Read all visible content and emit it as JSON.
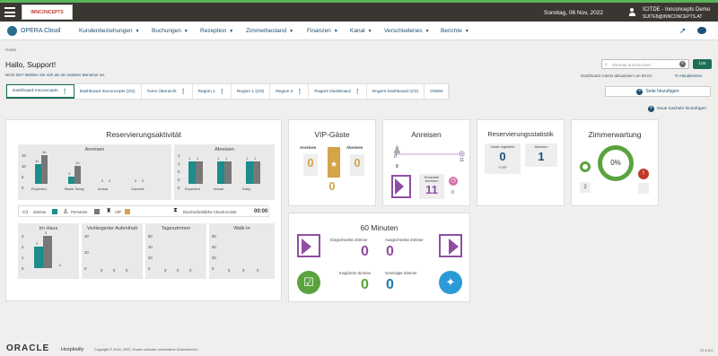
{
  "topbar": {
    "date": "Sonntag, 06 Nov, 2022",
    "user_line1": "ICITDE - Innconcepts Demo",
    "user_line2": "SUITE8@INNCONCEPTS.AT",
    "logo_text": "INNCONCEPTS"
  },
  "nav": {
    "app": "OPERA Cloud",
    "items": [
      "Kundenbeziehungen",
      "Buchungen",
      "Rezeption",
      "Zimmerbestand",
      "Finanzen",
      "Kanal",
      "Verschiedenes",
      "Berichte"
    ]
  },
  "breadcrumb": "Home",
  "greeting": "Hallo, Support!",
  "not_you": "Nicht Sie? Melden Sie sich als ein anderer Benutzer an.",
  "search": {
    "placeholder": "Sitemap durchsuchen",
    "go": "Los"
  },
  "updated": "Dashboard zuletzt aktualisiert um 09:04.",
  "refresh": "Aktualisieren",
  "tabs": [
    "Dashboard Innconcepts",
    "Dashboard Innconcepts (2/2)",
    "Toms Übersicht",
    "Region 1",
    "Region 1 (2/2)",
    "Region 2",
    "Rogers Dashboard",
    "Rogers Dashboard (2/2)",
    "OSEM"
  ],
  "add_page": "Seite hinzufügen",
  "new_tiles": "Neue Kacheln hinzufügen",
  "res_activity": {
    "title": "Reservierungsaktivität",
    "arrivals": {
      "label": "Anreisen",
      "yticks": [
        "15",
        "10",
        "5",
        "0"
      ],
      "categories": [
        "Expected",
        "Made Today",
        "Actual",
        "Cancels"
      ],
      "rooms": [
        11,
        4,
        0,
        0
      ],
      "persons": [
        16,
        10,
        0,
        0
      ]
    },
    "departures": {
      "label": "Abreisen",
      "yticks": [
        "1",
        "1",
        "0",
        "0",
        "0"
      ],
      "categories": [
        "Expected",
        "Actual",
        "Early"
      ],
      "rooms": [
        1,
        1,
        1
      ],
      "persons": [
        1,
        1,
        1
      ]
    },
    "legend": {
      "rooms": "Zimmer",
      "persons": "Personen",
      "vip": "VIP",
      "checkin": "Durchschnittliche Check-in-Zeit",
      "checkin_value": "00:00"
    },
    "in_house": {
      "label": "Im Haus",
      "yticks": [
        "3",
        "2",
        "1",
        "0"
      ],
      "rooms": 2,
      "persons": 3,
      "vip": 0
    },
    "extended": {
      "label": "Verlängerter Aufenthalt",
      "yticks": [
        "40",
        "20",
        "0"
      ],
      "values": [
        0,
        0,
        0
      ]
    },
    "day_rooms": {
      "label": "Tageszimmer",
      "yticks": [
        "60",
        "40",
        "20",
        "0"
      ],
      "values": [
        0,
        0,
        0
      ]
    },
    "walkin": {
      "label": "Walk-In",
      "yticks": [
        "60",
        "40",
        "20",
        "0"
      ],
      "values": [
        0,
        0,
        0
      ]
    }
  },
  "vip": {
    "title": "VIP-Gäste",
    "arrivals_label": "Anreisen",
    "departures_label": "Abreisen",
    "arrivals": "0",
    "departures": "0",
    "inhouse": "0"
  },
  "arrivals_tile": {
    "title": "Anreisen",
    "left_value": "0",
    "right_value": "11",
    "axis_zero": "0",
    "expected_label": "Erwartete Anreisen",
    "expected": "11",
    "late": "0"
  },
  "res_stats": {
    "title": "Reservierungsstatistik",
    "made_label": "Vorab registriert",
    "made": "0",
    "made_sub": "0 VIP",
    "dep_label": "Abreisen",
    "dep": "1"
  },
  "room_wait": {
    "title": "Zimmerwartung",
    "pct": "0%",
    "count": "2"
  },
  "sixty": {
    "title": "60 Minuten",
    "checked_in_label": "Eingecheckte Zimmer",
    "checked_in": "0",
    "checked_out_label": "Ausgecheckte Zimmer",
    "checked_out": "0",
    "inspected_label": "Inspizierte Zimmer",
    "inspected": "0",
    "cleaned_label": "Gereinigte Zimmer",
    "cleaned": "0"
  },
  "footer": {
    "oracle": "ORACLE",
    "hospitality": "Hospitality",
    "copyright": "Copyright © 2016, 2022, Oracle und/oder verbundene Unternehmen.",
    "version": "21.5.4.0"
  },
  "colors": {
    "teal": "#1c8c8c",
    "gray": "#777777",
    "gold": "#d4a34a",
    "purple": "#8e4fa3",
    "green": "#5aa33f",
    "blue": "#1c7ab0"
  }
}
